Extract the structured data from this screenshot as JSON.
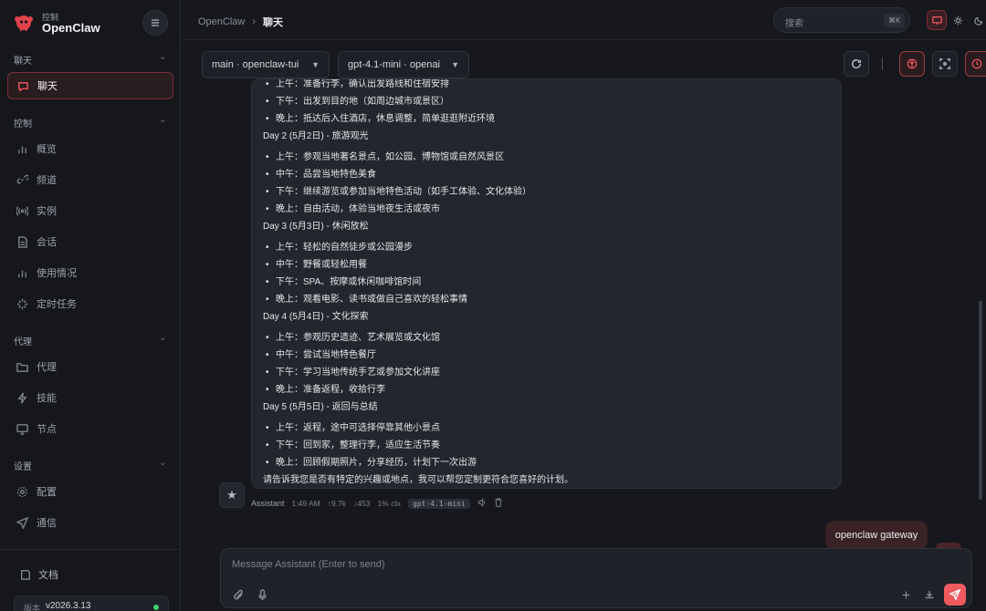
{
  "brand": {
    "sub": "控制",
    "title": "OpenClaw"
  },
  "sidebar": {
    "sections": {
      "chat": "聊天",
      "control": "控制",
      "agent": "代理",
      "settings": "设置"
    },
    "items": [
      {
        "label": "聊天",
        "icon": "chat-icon"
      },
      {
        "label": "概览",
        "icon": "bar-chart-icon"
      },
      {
        "label": "频道",
        "icon": "link-icon"
      },
      {
        "label": "实例",
        "icon": "broadcast-icon"
      },
      {
        "label": "会话",
        "icon": "document-icon"
      },
      {
        "label": "使用情况",
        "icon": "bar-chart-icon"
      },
      {
        "label": "定时任务",
        "icon": "sparkle-icon"
      },
      {
        "label": "代理",
        "icon": "folder-icon"
      },
      {
        "label": "技能",
        "icon": "lightning-icon"
      },
      {
        "label": "节点",
        "icon": "monitor-icon"
      },
      {
        "label": "配置",
        "icon": "gear-icon"
      },
      {
        "label": "通信",
        "icon": "send-icon"
      }
    ],
    "docs": "文档",
    "version": {
      "label": "版本",
      "value": "v2026.3.13"
    }
  },
  "header": {
    "breadcrumb_root": "OpenClaw",
    "breadcrumb_sep": "›",
    "breadcrumb_current": "聊天",
    "search_placeholder": "搜索",
    "search_shortcut": "⌘K"
  },
  "toolbar": {
    "session": "main · openclaw-tui",
    "model": "gpt-4.1-mini · openai"
  },
  "chat": {
    "top_partial": "上午：准备行李，确认出发路线和住宿安排",
    "intro": [
      "下午：出发到目的地（如周边城市或景区）",
      "晚上：抵达后入住酒店，休息调整，简单逛逛附近环境"
    ],
    "days": [
      {
        "title": "Day 2 (5月2日) - 旅游观光",
        "items": [
          "上午：参观当地著名景点，如公园、博物馆或自然风景区",
          "中午：品尝当地特色美食",
          "下午：继续游览或参加当地特色活动（如手工体验、文化体验）",
          "晚上：自由活动，体验当地夜生活或夜市"
        ]
      },
      {
        "title": "Day 3 (5月3日) - 休闲放松",
        "items": [
          "上午：轻松的自然徒步或公园漫步",
          "中午：野餐或轻松用餐",
          "下午：SPA、按摩或休闲咖啡馆时间",
          "晚上：观看电影、读书或做自己喜欢的轻松事情"
        ]
      },
      {
        "title": "Day 4 (5月4日) - 文化探索",
        "items": [
          "上午：参观历史遗迹、艺术展览或文化馆",
          "中午：尝试当地特色餐厅",
          "下午：学习当地传统手艺或参加文化讲座",
          "晚上：准备返程，收拾行李"
        ]
      },
      {
        "title": "Day 5 (5月5日) - 返回与总结",
        "items": [
          "上午：返程，途中可选择停靠其他小景点",
          "下午：回到家，整理行李，适应生活节奏",
          "晚上：回顾假期照片，分享经历，计划下一次出游"
        ]
      }
    ],
    "closing": "请告诉我您是否有特定的兴趣或地点，我可以帮您定制更符合您喜好的计划。",
    "meta": {
      "sender": "Assistant",
      "time": "1:49 AM",
      "tokens_in": "↑9.7k",
      "tokens_out": "↓453",
      "ctx": "1% ctx",
      "model": "gpt-4.1-mini"
    },
    "user_message": "openclaw gateway"
  },
  "composer": {
    "placeholder": "Message Assistant (Enter to send)"
  },
  "colors": {
    "accent": "#ef5a5f",
    "status_online": "#3ecf6e"
  }
}
